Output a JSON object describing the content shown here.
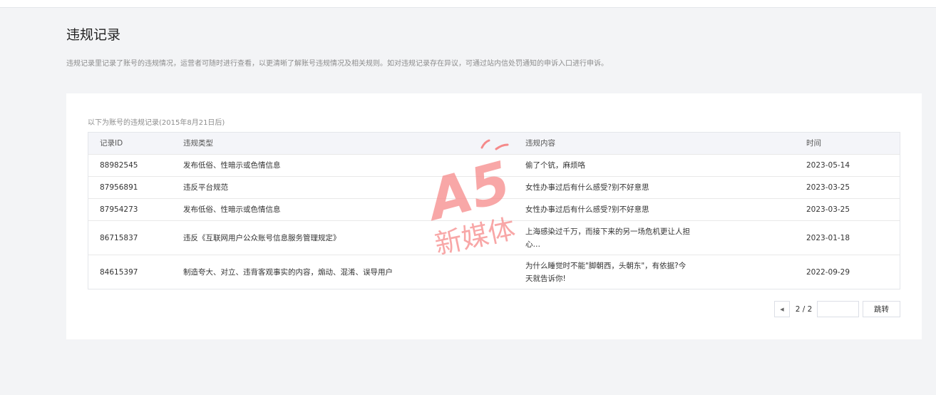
{
  "page": {
    "title": "违规记录",
    "description": "违规记录里记录了账号的违规情况，运营者可随时进行查看，以更清晰了解账号违规情况及相关规则。如对违规记录存在异议，可通过站内信处罚通知的申诉入口进行申诉。"
  },
  "records": {
    "caption": "以下为账号的违规记录(2015年8月21日后)",
    "columns": [
      "记录ID",
      "违规类型",
      "违规内容",
      "时间"
    ],
    "rows": [
      {
        "id": "88982545",
        "type": "发布低俗、性暗示或色情信息",
        "content": "偷了个钪，麻烦咯",
        "time": "2023-05-14"
      },
      {
        "id": "87956891",
        "type": "违反平台规范",
        "content": "女性办事过后有什么感受?别不好意思",
        "time": "2023-03-25"
      },
      {
        "id": "87954273",
        "type": "发布低俗、性暗示或色情信息",
        "content": "女性办事过后有什么感受?别不好意思",
        "time": "2023-03-25"
      },
      {
        "id": "86715837",
        "type": "违反《互联网用户公众账号信息服务管理规定》",
        "content": "上海感染过千万，而接下来的另一场危机更让人担心…",
        "time": "2023-01-18"
      },
      {
        "id": "84615397",
        "type": "制造夸大、对立、违背客观事实的内容，煽动、混淆、误导用户",
        "content": "为什么睡觉时不能\"脚朝西，头朝东\"，有依据?今天就告诉你!",
        "time": "2022-09-29"
      }
    ]
  },
  "pagination": {
    "prev_icon": "caret-left-icon",
    "page_info": "2 / 2",
    "jump_input_value": "",
    "jump_label": "跳转"
  },
  "watermark": {
    "logo_text": "A5",
    "subtitle": "新媒体",
    "color": "#f26b6b"
  },
  "colors": {
    "background": "#f3f4f6",
    "card": "#ffffff",
    "table_header": "#f4f5f9"
  }
}
